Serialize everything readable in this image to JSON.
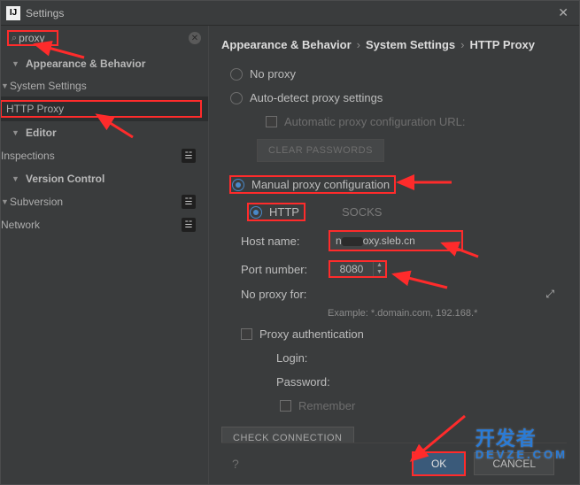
{
  "window": {
    "title": "Settings"
  },
  "search": {
    "value": "proxy"
  },
  "sidebar": {
    "items": [
      {
        "label": "Appearance & Behavior"
      },
      {
        "label": "System Settings"
      },
      {
        "label": "HTTP Proxy"
      },
      {
        "label": "Editor"
      },
      {
        "label": "Inspections"
      },
      {
        "label": "Version Control"
      },
      {
        "label": "Subversion"
      },
      {
        "label": "Network"
      }
    ]
  },
  "breadcrumb": {
    "a": "Appearance & Behavior",
    "b": "System Settings",
    "c": "HTTP Proxy"
  },
  "proxy": {
    "no_proxy": "No proxy",
    "auto": "Auto-detect proxy settings",
    "auto_url": "Automatic proxy configuration URL:",
    "clear_pw": "CLEAR PASSWORDS",
    "manual": "Manual proxy configuration",
    "http": "HTTP",
    "socks": "SOCKS",
    "host_label": "Host name:",
    "host_value_prefix": "n",
    "host_value_suffix": "oxy.sleb.cn",
    "port_label": "Port number:",
    "port_value": "8080",
    "noproxyfor_label": "No proxy for:",
    "example": "Example: *.domain.com, 192.168.*",
    "auth": "Proxy authentication",
    "login": "Login:",
    "password": "Password:",
    "remember": "Remember",
    "check": "CHECK CONNECTION"
  },
  "footer": {
    "ok": "OK",
    "cancel": "CANCEL"
  },
  "watermark": {
    "top": "开发者",
    "bottom": "DEVZE.COM"
  }
}
